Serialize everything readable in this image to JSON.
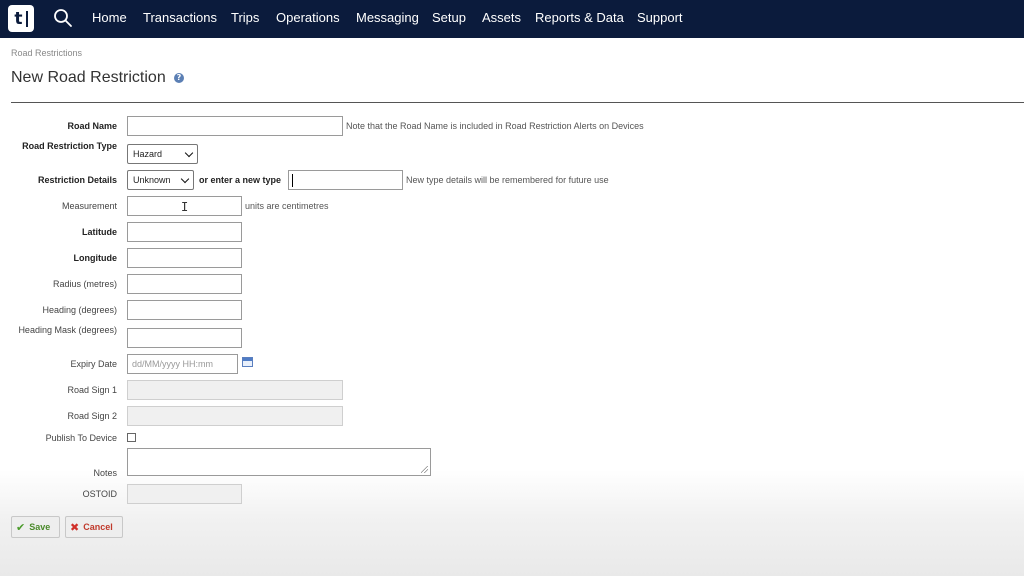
{
  "nav": {
    "logo_text": "t",
    "items": [
      "Home",
      "Transactions",
      "Trips",
      "Operations",
      "Messaging",
      "Setup",
      "Assets",
      "Reports & Data",
      "Support"
    ]
  },
  "breadcrumb": "Road Restrictions",
  "title": "New Road Restriction",
  "help_icon": "?",
  "form": {
    "road_name": {
      "label": "Road Name",
      "value": "",
      "note": "Note that the Road Name is included in Road Restriction Alerts on Devices"
    },
    "type": {
      "label": "Road Restriction Type",
      "selected": "Hazard"
    },
    "details": {
      "label": "Restriction Details",
      "selected": "Unknown",
      "or_label": "or enter a new type",
      "new_type_value": "",
      "note": "New type details will be remembered for future use"
    },
    "measurement": {
      "label": "Measurement",
      "value": "",
      "note": "units are centimetres"
    },
    "latitude": {
      "label": "Latitude",
      "value": ""
    },
    "longitude": {
      "label": "Longitude",
      "value": ""
    },
    "radius": {
      "label": "Radius (metres)",
      "value": ""
    },
    "heading": {
      "label": "Heading (degrees)",
      "value": ""
    },
    "heading_mask": {
      "label": "Heading Mask (degrees)",
      "value": ""
    },
    "expiry": {
      "label": "Expiry Date",
      "placeholder": "dd/MM/yyyy HH:mm"
    },
    "road_sign_1": {
      "label": "Road Sign 1",
      "value": ""
    },
    "road_sign_2": {
      "label": "Road Sign 2",
      "value": ""
    },
    "publish": {
      "label": "Publish To Device",
      "checked": false
    },
    "notes": {
      "label": "Notes",
      "value": ""
    },
    "ostoid": {
      "label": "OSTOID",
      "value": ""
    }
  },
  "buttons": {
    "save": {
      "label": "Save",
      "icon": "check-icon"
    },
    "cancel": {
      "label": "Cancel",
      "icon": "x-icon"
    }
  }
}
